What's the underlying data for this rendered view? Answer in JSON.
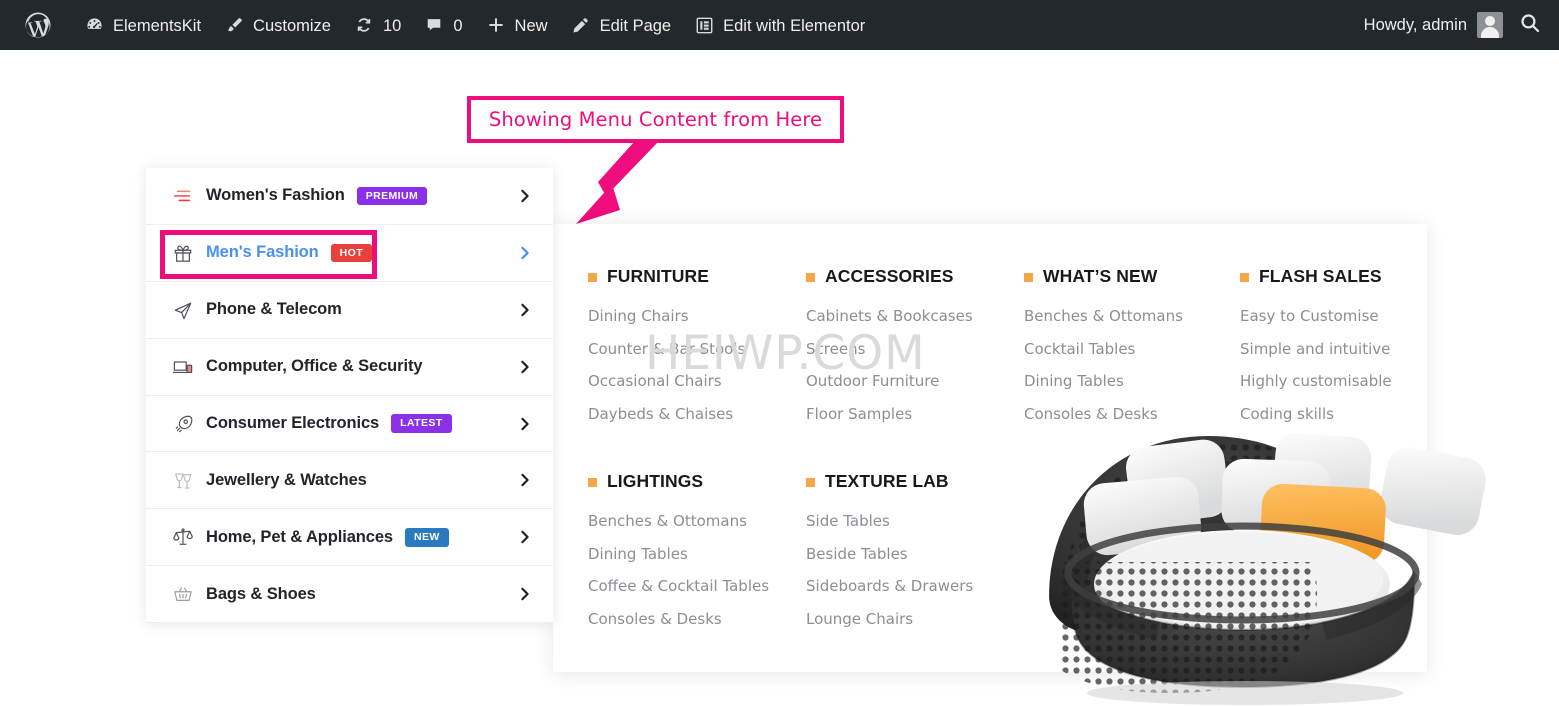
{
  "adminbar": {
    "items": [
      {
        "icon": "wordpress-logo-icon",
        "label": ""
      },
      {
        "icon": "dashboard-icon",
        "label": "ElementsKit"
      },
      {
        "icon": "paintbrush-icon",
        "label": "Customize"
      },
      {
        "icon": "updates-icon",
        "label": "10"
      },
      {
        "icon": "comment-bubble-icon",
        "label": "0"
      },
      {
        "icon": "plus-icon",
        "label": "New"
      },
      {
        "icon": "pencil-icon",
        "label": "Edit Page"
      },
      {
        "icon": "elementor-icon",
        "label": "Edit with Elementor"
      }
    ],
    "howdy": "Howdy, admin",
    "search_icon": "search-icon",
    "avatar": "avatar",
    "bg_color": "#23282d"
  },
  "callout": {
    "text": "Showing Menu Content from Here",
    "color": "#ef0c7d"
  },
  "sidebar": {
    "items": [
      {
        "icon": "menu-lines-icon",
        "label": "Women's Fashion",
        "badge": "PREMIUM",
        "badge_color": "#8b30e8",
        "active": false
      },
      {
        "icon": "gift-icon",
        "label": "Men's Fashion",
        "badge": "HOT",
        "badge_color": "#e8413c",
        "active": true
      },
      {
        "icon": "paper-plane-icon",
        "label": "Phone & Telecom",
        "badge": "",
        "badge_color": "",
        "active": false
      },
      {
        "icon": "laptop-icon",
        "label": "Computer, Office & Security",
        "badge": "",
        "badge_color": "",
        "active": false
      },
      {
        "icon": "rocket-icon",
        "label": "Consumer Electronics",
        "badge": "LATEST",
        "badge_color": "#8b30e8",
        "active": false
      },
      {
        "icon": "champagne-glasses-icon",
        "label": "Jewellery & Watches",
        "badge": "",
        "badge_color": "",
        "active": false
      },
      {
        "icon": "scales-icon",
        "label": "Home, Pet & Appliances",
        "badge": "NEW",
        "badge_color": "#2a7ac0",
        "active": false
      },
      {
        "icon": "basket-icon",
        "label": "Bags & Shoes",
        "badge": "",
        "badge_color": "",
        "active": false
      }
    ],
    "active_color": "#4a90f4"
  },
  "mega": {
    "bullet_color": "#f5a646",
    "columns": [
      {
        "title": "FURNITURE",
        "links": [
          "Dining Chairs",
          "Counter & Bar Stools",
          "Occasional Chairs",
          "Daybeds & Chaises"
        ]
      },
      {
        "title": "ACCESSORIES",
        "links": [
          "Cabinets & Bookcases",
          "Screens",
          "Outdoor Furniture",
          "Floor Samples"
        ]
      },
      {
        "title": "WHAT’S NEW",
        "links": [
          "Benches & Ottomans",
          "Cocktail Tables",
          "Dining Tables",
          "Consoles & Desks"
        ]
      },
      {
        "title": "FLASH SALES",
        "links": [
          "Easy to Customise",
          "Simple and intuitive",
          "Highly customisable",
          "Coding skills"
        ]
      },
      {
        "title": "LIGHTINGS",
        "links": [
          "Benches & Ottomans",
          "Dining Tables",
          "Coffee & Cocktail Tables",
          "Consoles & Desks"
        ]
      },
      {
        "title": "TEXTURE LAB",
        "links": [
          "Side Tables",
          "Beside Tables",
          "Sideboards & Drawers",
          "Lounge Chairs"
        ]
      }
    ],
    "product_image": "round-wicker-daybed-with-pillows"
  },
  "watermark": {
    "text": "HEIWP.COM"
  }
}
